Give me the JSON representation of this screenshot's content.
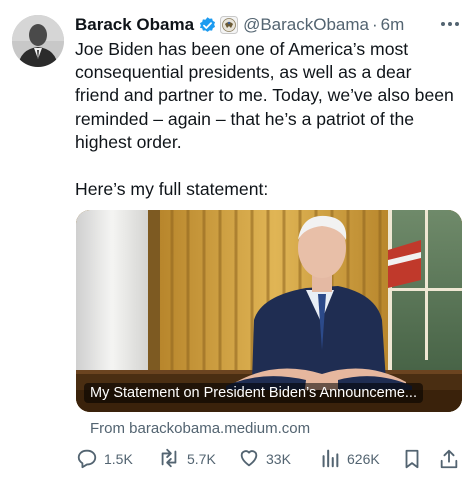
{
  "author": {
    "name": "Barack Obama",
    "handle": "@BarackObama",
    "separator": "·",
    "time": "6m"
  },
  "tweet": {
    "text": "Joe Biden has been one of America’s most consequential presidents, as well as a dear friend and partner to me. Today, we’ve also been reminded – again – that he’s a patriot of the highest order.",
    "text2": "Here’s my full statement:"
  },
  "card": {
    "title": "My Statement on President Biden’s Announceme...",
    "source": "From barackobama.medium.com"
  },
  "actions": {
    "replies": "1.5K",
    "reposts": "5.7K",
    "likes": "33K",
    "views": "626K"
  },
  "colors": {
    "text": "#0f1419",
    "secondary": "#536471",
    "verified": "#1d9bf0"
  },
  "icons": [
    "verified-badge-icon",
    "government-seal-icon",
    "more-icon",
    "reply-icon",
    "repost-icon",
    "like-icon",
    "views-icon",
    "bookmark-icon",
    "share-icon"
  ]
}
